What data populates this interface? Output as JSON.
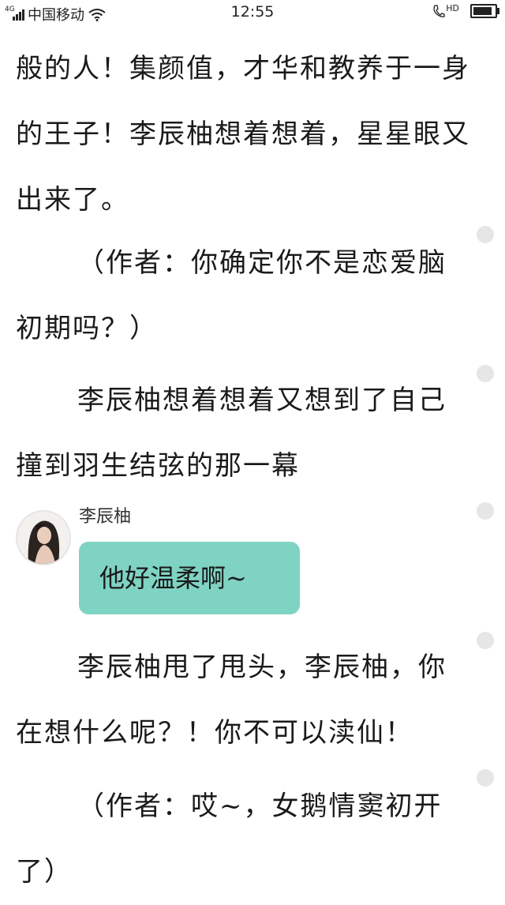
{
  "status_bar": {
    "network": "4G",
    "carrier": "中国移动",
    "time": "12:55",
    "call_label": "HD",
    "battery_level": 0.9
  },
  "paragraphs": {
    "p1": "般的人！集颜值，才华和教养于一身的王子！李辰柚想着想着，星星眼又出来了。",
    "p2": "（作者：你确定你不是恋爱脑初期吗？）",
    "p3": "李辰柚想着想着又想到了自己撞到羽生结弦的那一幕",
    "p4": "李辰柚甩了甩头，李辰柚，你在想什么呢？！你不可以渎仙！",
    "p5": "（作者：哎~，女鹅情窦初开了）"
  },
  "chat": {
    "speaker": "李辰柚",
    "message": "他好温柔啊~"
  }
}
